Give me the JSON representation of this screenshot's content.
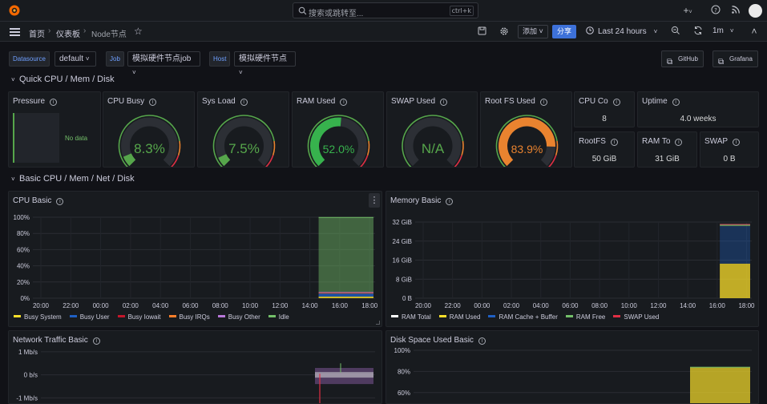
{
  "topbar": {
    "search_placeholder": "搜索或跳转至...",
    "search_shortcut": "ctrl+k",
    "icons": [
      "plus-icon",
      "help-icon",
      "news-icon",
      "avatar"
    ]
  },
  "breadcrumb": {
    "home": "首页",
    "dashboards": "仪表板",
    "current": "Node节点"
  },
  "toolbar": {
    "add_label": "添加",
    "share_label": "分享",
    "time_range": "Last 24 hours",
    "refresh_interval": "1m"
  },
  "variables": [
    {
      "label": "Datasource",
      "value": "default"
    },
    {
      "label": "Job",
      "value": "模拟硬件节点job"
    },
    {
      "label": "Host",
      "value": "模拟硬件节点"
    }
  ],
  "links": {
    "github": "GitHub",
    "grafana": "Grafana"
  },
  "rows": {
    "quick": "Quick CPU / Mem / Disk",
    "basic": "Basic CPU / Mem / Net / Disk"
  },
  "colors": {
    "accent": "#3d71d9",
    "green": "#56a64b",
    "bright_green": "#37b24d",
    "orange": "#e9832f",
    "red": "#e02f44",
    "yellow": "#fade2a",
    "blue": "#1f60c4"
  },
  "pressure": {
    "title": "Pressure",
    "no_data": "No data"
  },
  "gauges": [
    {
      "title": "CPU Busy",
      "value": "8.3%",
      "fraction": 0.083,
      "color": "#56a64b"
    },
    {
      "title": "Sys Load",
      "value": "7.5%",
      "fraction": 0.075,
      "color": "#56a64b"
    },
    {
      "title": "RAM Used",
      "value": "52.0%",
      "fraction": 0.52,
      "color": "#37b24d"
    },
    {
      "title": "SWAP Used",
      "value": "N/A",
      "fraction": 0,
      "color": "#56a64b"
    },
    {
      "title": "Root FS Used",
      "value": "83.9%",
      "fraction": 0.839,
      "color": "#e9832f"
    }
  ],
  "stats": {
    "cpu_cores": {
      "title": "CPU Co",
      "value": "8"
    },
    "uptime": {
      "title": "Uptime",
      "value": "4.0 weeks"
    },
    "rootfs": {
      "title": "RootFS",
      "value": "50 GiB"
    },
    "ram_total": {
      "title": "RAM To",
      "value": "31 GiB"
    },
    "swap_total": {
      "title": "SWAP",
      "value": "0 B"
    }
  },
  "panels": {
    "cpu_basic": {
      "title": "CPU Basic",
      "legend": [
        {
          "name": "Busy System",
          "color": "#fade2a"
        },
        {
          "name": "Busy User",
          "color": "#1f60c4"
        },
        {
          "name": "Busy Iowait",
          "color": "#c4162a"
        },
        {
          "name": "Busy IRQs",
          "color": "#ff7f2a"
        },
        {
          "name": "Busy Other",
          "color": "#b877d9"
        },
        {
          "name": "Idle",
          "color": "#73bf69"
        }
      ]
    },
    "memory_basic": {
      "title": "Memory Basic",
      "legend": [
        {
          "name": "RAM Total",
          "color": "#ffffff"
        },
        {
          "name": "RAM Used",
          "color": "#fade2a"
        },
        {
          "name": "RAM Cache + Buffer",
          "color": "#1f60c4"
        },
        {
          "name": "RAM Free",
          "color": "#73bf69"
        },
        {
          "name": "SWAP Used",
          "color": "#e02f44"
        }
      ]
    },
    "network_basic": {
      "title": "Network Traffic Basic"
    },
    "disk_basic": {
      "title": "Disk Space Used Basic"
    }
  },
  "chart_data": [
    {
      "type": "area",
      "title": "CPU Basic",
      "x": [
        "20:00",
        "22:00",
        "00:00",
        "02:00",
        "04:00",
        "06:00",
        "08:00",
        "10:00",
        "12:00",
        "14:00",
        "16:00",
        "18:00"
      ],
      "y_ticks": [
        "0%",
        "20%",
        "40%",
        "60%",
        "80%",
        "100%"
      ],
      "ylim": [
        0,
        100
      ],
      "data_window": [
        "14:20",
        "18:40"
      ],
      "series": [
        {
          "name": "Busy System",
          "values": [
            2
          ]
        },
        {
          "name": "Busy User",
          "values": [
            4
          ]
        },
        {
          "name": "Busy Iowait",
          "values": [
            0.5
          ]
        },
        {
          "name": "Busy IRQs",
          "values": [
            0.3
          ]
        },
        {
          "name": "Busy Other",
          "values": [
            1
          ]
        },
        {
          "name": "Idle",
          "values": [
            92
          ]
        }
      ]
    },
    {
      "type": "area",
      "title": "Memory Basic",
      "x": [
        "20:00",
        "22:00",
        "00:00",
        "02:00",
        "04:00",
        "06:00",
        "08:00",
        "10:00",
        "12:00",
        "14:00",
        "16:00",
        "18:00"
      ],
      "y_ticks": [
        "0 B",
        "8 GiB",
        "16 GiB",
        "24 GiB",
        "32 GiB"
      ],
      "ylim": [
        0,
        32
      ],
      "data_window": [
        "14:20",
        "18:40"
      ],
      "series": [
        {
          "name": "RAM Total",
          "values": [
            31
          ]
        },
        {
          "name": "RAM Used",
          "values": [
            14.5
          ]
        },
        {
          "name": "RAM Cache + Buffer",
          "values": [
            15.8
          ]
        },
        {
          "name": "RAM Free",
          "values": [
            0.7
          ]
        },
        {
          "name": "SWAP Used",
          "values": [
            0
          ]
        }
      ]
    },
    {
      "type": "area",
      "title": "Network Traffic Basic",
      "y_ticks": [
        "1 Mb/s",
        "0 b/s",
        "-1 Mb/s"
      ],
      "ylim": [
        -1.3,
        1.1
      ]
    },
    {
      "type": "area",
      "title": "Disk Space Used Basic",
      "y_ticks": [
        "100%",
        "80%",
        "60%"
      ],
      "ylim": [
        50,
        100
      ],
      "series": [
        {
          "name": "/",
          "values": [
            84
          ]
        }
      ]
    }
  ]
}
